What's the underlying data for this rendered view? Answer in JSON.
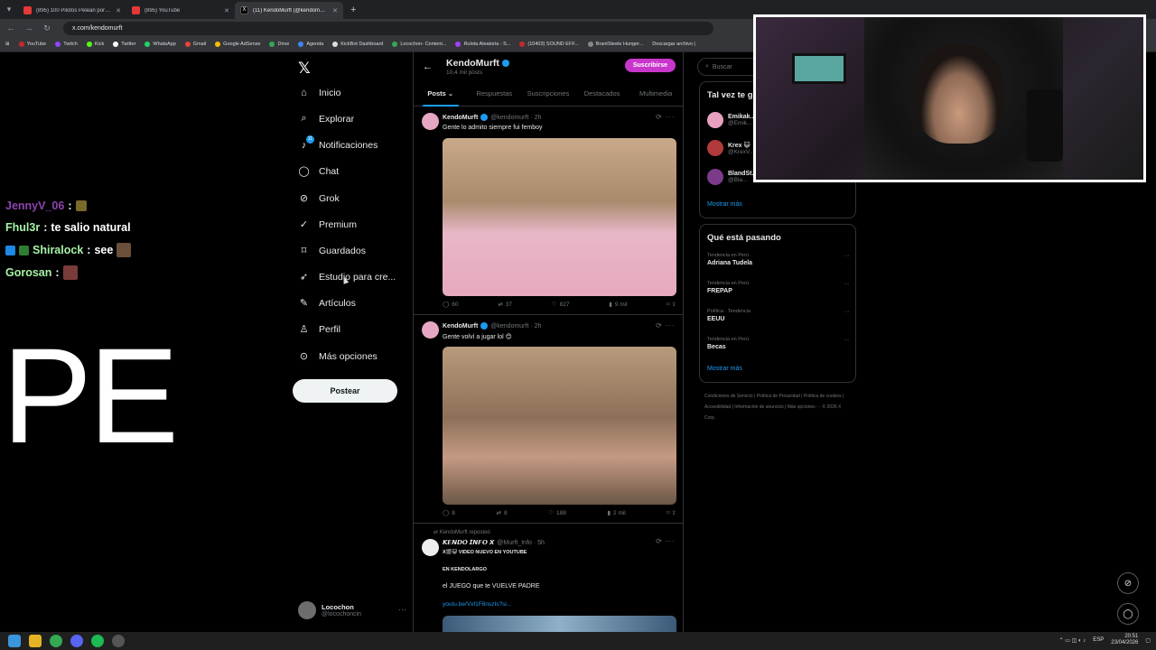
{
  "browser": {
    "tabs": [
      {
        "title": "(895) 100 Pilotos Pelean por un...",
        "icon": "youtube-icon"
      },
      {
        "title": "(895) YouTube",
        "icon": "youtube-icon"
      },
      {
        "title": "(11) KendoMurft (@kendomurft...",
        "icon": "x-icon",
        "active": true
      }
    ],
    "url": "x.com/kendomurft",
    "bookmarks": [
      "YouTube",
      "Twitch",
      "Kick",
      "Twitter",
      "WhatsApp",
      "Gmail",
      "Google AdSense",
      "Drive",
      "Agenda",
      "KickBot Dashboard",
      "Locochon- Content...",
      "Ruleta Aleatoria - S...",
      "(10403) SOUND EFF...",
      "BrantSteele Hunger...",
      "Descargar archivo |"
    ]
  },
  "stream_chat": [
    {
      "user": "JennyV_06",
      "message": "",
      "user_color": "#8e44ad"
    },
    {
      "user": "Fhul3r",
      "message": "te salio natural",
      "user_color": "#a7f3a7"
    },
    {
      "user": "Shiralock",
      "message": "see",
      "user_color": "#a7f3a7"
    },
    {
      "user": "Gorosan",
      "message": "",
      "user_color": "#a7f3a7"
    }
  ],
  "overlay_text": "PE",
  "x_nav": {
    "items": [
      {
        "label": "Inicio",
        "icon": "home-icon"
      },
      {
        "label": "Explorar",
        "icon": "search-icon"
      },
      {
        "label": "Notificaciones",
        "icon": "bell-icon"
      },
      {
        "label": "Chat",
        "icon": "chat-icon"
      },
      {
        "label": "Grok",
        "icon": "grok-icon"
      },
      {
        "label": "Premium",
        "icon": "premium-icon"
      },
      {
        "label": "Guardados",
        "icon": "bookmark-icon"
      },
      {
        "label": "Estudio para cre...",
        "icon": "rocket-icon"
      },
      {
        "label": "Artículos",
        "icon": "article-icon"
      },
      {
        "label": "Perfil",
        "icon": "person-icon"
      },
      {
        "label": "Más opciones",
        "icon": "more-icon"
      }
    ],
    "notif_count": "11",
    "post_button": "Postear",
    "account": {
      "name": "Locochon",
      "handle": "@locochoncin"
    }
  },
  "profile": {
    "name": "KendoMurft",
    "posts_count": "10,4 mil posts",
    "subscribe": "Suscribirse",
    "tabs": [
      "Posts",
      "Respuestas",
      "Suscripciones",
      "Destacados",
      "Multimedia"
    ]
  },
  "posts": [
    {
      "author": "KendoMurft",
      "handle": "@kendomurft · 2h",
      "text": "Gente lo admito siempre fui femboy",
      "replies": "60",
      "reposts": "37",
      "likes": "827",
      "views": "9 mil"
    },
    {
      "author": "KendoMurft",
      "handle": "@kendomurft · 2h",
      "text": "Gente volví a jugar lol 😊",
      "replies": "8",
      "reposts": "8",
      "likes": "188",
      "views": "2 mil"
    },
    {
      "repost_label": "KendoMurft reposteó",
      "author": "𝙆𝙀𝙉𝘿𝙊 𝙄𝙉𝙁𝙊 𝙓",
      "handle": "@Murft_Info · 5h",
      "line1": "X🎬😺 VIDEO NUEVO EN YOUTUBE",
      "line2": "EN KENDOLARGO",
      "line3": "el JUEGO  que te VUELVE PADRE",
      "link": "youtu.be/Vxf1F8nszIs?si..."
    }
  ],
  "right": {
    "search_placeholder": "Buscar",
    "who_to_follow_title": "Tal vez te g...",
    "suggestions": [
      {
        "name": "Emikak...",
        "handle": "@Emik..."
      },
      {
        "name": "Krex 😺",
        "handle": "@KrexV..."
      },
      {
        "name": "BlandSt...",
        "handle": "@Bla..."
      }
    ],
    "show_more": "Mostrar más",
    "trends_title": "Qué está pasando",
    "trends": [
      {
        "context": "Tendencia en Perú",
        "name": "Adriana Tudela"
      },
      {
        "context": "Tendencia en Perú",
        "name": "FREPAP"
      },
      {
        "context": "Política · Tendencia",
        "name": "EEUU"
      },
      {
        "context": "Tendencia en Perú",
        "name": "Becas"
      }
    ],
    "footer": "Condiciones de Servicio  |  Política de Privacidad  |  Política de cookies  |  Accesibilidad  |  Información de anuncios  |  Más opciones ···  © 2026 X Corp."
  },
  "taskbar": {
    "lang": "ESP",
    "time": "20:51",
    "date": "23/04/2026"
  }
}
